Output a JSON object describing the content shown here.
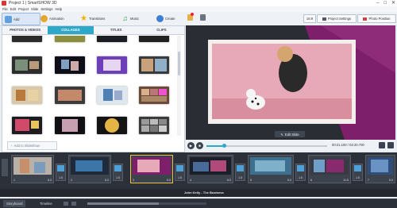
{
  "window": {
    "title": "Project 1 | SmartSHOW 3D"
  },
  "menu": [
    "File",
    "Edit",
    "Project",
    "Slide",
    "Settings",
    "Help"
  ],
  "toolbar": {
    "add": "Add",
    "animation": "Animation",
    "transitions": "Transitions",
    "music": "Music",
    "create": "Create",
    "ratio": "16:9",
    "project_settings": "Project Settings",
    "photo_position": "Photo Position"
  },
  "left_tabs": [
    "PHOTOS & VIDEOS",
    "COLLAGES",
    "TITLES",
    "CLIPS"
  ],
  "add_to_slideshow": "Add to Slideshow",
  "preview": {
    "edit_slide": "Edit Slide"
  },
  "player": {
    "time": "00:21.100 / 02:20.700"
  },
  "storyboard": {
    "slides": [
      {
        "num": "1",
        "dur": "5.0"
      },
      {
        "num": "2",
        "dur": "5.0"
      },
      {
        "num": "3",
        "dur": "5.0"
      },
      {
        "num": "4",
        "dur": "5.0"
      },
      {
        "num": "5",
        "dur": "5.0"
      },
      {
        "num": "6",
        "dur": "11.5"
      },
      {
        "num": "7",
        "dur": "5.0"
      }
    ],
    "transitions": [
      "1.5",
      "1.5",
      "1.5",
      "1.5",
      "1.5",
      "1.5"
    ],
    "audio_track": "John Kelly - The Business"
  },
  "bottom_tabs": [
    "Storyboard",
    "Timeline"
  ],
  "colors": {
    "accent": "#2ea8c9",
    "magenta": "#7d1f6a"
  }
}
